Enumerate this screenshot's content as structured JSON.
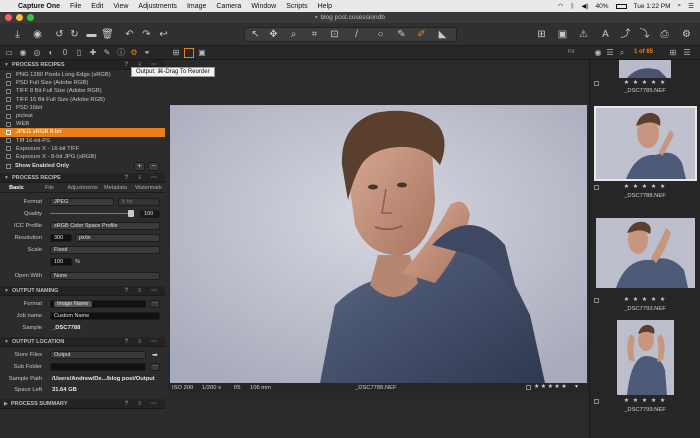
{
  "menubar": {
    "app": "Capture One",
    "items": [
      "File",
      "Edit",
      "View",
      "Adjustments",
      "Image",
      "Camera",
      "Window",
      "Scripts",
      "Help"
    ],
    "battery": "40%",
    "clock": "Tue 1:22 PM"
  },
  "window": {
    "title": "blog post.cosessiondb"
  },
  "tooltip": "Output: ⌘-Drag To Reorder",
  "process_recipes": {
    "header": "PROCESS RECIPES",
    "items": [
      {
        "label": "PNG 1280 Pixels Long Edge (sRGB)",
        "selected": false
      },
      {
        "label": "PSD Full Size (Adobe RGB)",
        "selected": false
      },
      {
        "label": "TIFF 8 Bit Full Size (Adobe RGB)",
        "selected": false
      },
      {
        "label": "TIFF 16 Bit Full Size (Adobe RGB)",
        "selected": false
      },
      {
        "label": "PSD 16bit",
        "selected": false
      },
      {
        "label": "picleat",
        "selected": false
      },
      {
        "label": "WEB",
        "selected": false
      },
      {
        "label": "JPEG sRGB 8-bit",
        "selected": true
      },
      {
        "label": "TIff 16-bit-PS",
        "selected": false
      },
      {
        "label": "Exposure X - 16-bit TIFF",
        "selected": false
      },
      {
        "label": "Exposure X - 8-bit JPG (sRGB)",
        "selected": false
      }
    ],
    "show_enabled": "Show Enabled Only"
  },
  "process_recipe": {
    "header": "PROCESS RECIPE",
    "tabs": [
      "Basic",
      "File",
      "Adjustments",
      "Metadata",
      "Watermark"
    ],
    "format_label": "Format",
    "format_value": "JPEG",
    "bit_value": "8 bit",
    "quality_label": "Quality",
    "quality_value": "100",
    "icc_label": "ICC Profile",
    "icc_value": "sRGB Color Space Profile",
    "resolution_label": "Resolution",
    "resolution_value": "300",
    "resolution_unit": "px/in",
    "scale_label": "Scale",
    "scale_value": "Fixed",
    "scale_pct": "100",
    "pct_sign": "%",
    "open_label": "Open With",
    "open_value": "None"
  },
  "output_naming": {
    "header": "OUTPUT NAMING",
    "format_label": "Format",
    "format_value": "Image Name",
    "job_label": "Job name",
    "job_value": "Custom Name",
    "sample_label": "Sample",
    "sample_value": "_DSC7788"
  },
  "output_location": {
    "header": "OUTPUT LOCATION",
    "store_label": "Store Files",
    "store_value": "Output",
    "sub_label": "Sub Folder",
    "sub_value": "",
    "path_label": "Sample Path",
    "path_value": "/Users/Andrew/De.../blog post/Output",
    "space_label": "Space Left",
    "space_value": "31.64 GB"
  },
  "process_summary": {
    "header": "PROCESS SUMMARY"
  },
  "viewer": {
    "fit": "Fit",
    "iso": "ISO 200",
    "shutter": "1/200 s",
    "aperture": "f/5",
    "focal": "106 mm",
    "filename": "_DSC7788.NEF",
    "stars": "★ ★ ★ ★ ★"
  },
  "browser": {
    "counter": "1 of 65",
    "thumbs": [
      {
        "name": "_DSC7785.NEF",
        "stars": "★ ★ ★ ★ ★"
      },
      {
        "name": "_DSC7788.NEF",
        "stars": "★ ★ ★ ★ ★"
      },
      {
        "name": "_DSC7793.NEF",
        "stars": "★ ★ ★ ★ ★"
      },
      {
        "name": "_DSC7799.NEF",
        "stars": "★ ★ ★ ★ ★"
      }
    ]
  },
  "colors": {
    "accent": "#e8811a",
    "panel": "#2c2c2c",
    "photo_bg": "#bfc1ce",
    "shirt": "#4d5a78"
  }
}
